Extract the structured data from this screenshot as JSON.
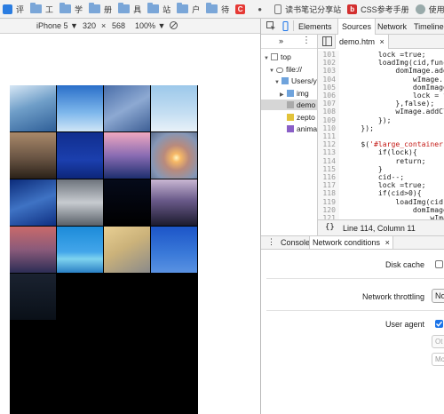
{
  "bookmarks": [
    {
      "label": "评",
      "icon": "browser-icon",
      "color": "#2b7de1"
    },
    {
      "label": "工",
      "icon": "folder-icon"
    },
    {
      "label": "学",
      "icon": "folder-icon"
    },
    {
      "label": "册",
      "icon": "folder-icon"
    },
    {
      "label": "具",
      "icon": "folder-icon"
    },
    {
      "label": "站",
      "icon": "folder-icon"
    },
    {
      "label": "户",
      "icon": "folder-icon"
    },
    {
      "label": "待",
      "icon": "folder-icon"
    },
    {
      "label": "",
      "icon": "c-logo-icon",
      "color": "#e53935"
    },
    {
      "label": "",
      "icon": "apple-icon"
    },
    {
      "label": "读书笔记分享站",
      "icon": "document-icon"
    },
    {
      "label": "CSS参考手册",
      "icon": "b-logo-icon",
      "color": "#d32f2f"
    },
    {
      "label": "使用ES6编写",
      "icon": "user-icon"
    }
  ],
  "device_toolbar": {
    "device": "iPhone 5 ▼",
    "width": "320",
    "times": "×",
    "height": "568",
    "zoom": "100% ▼"
  },
  "viewport": {
    "tiles": [
      {
        "name": "blossom-photo",
        "bg": "linear-gradient(160deg,#d7e7f5 0%,#6f9ec8 45%,#2f5f98 100%)"
      },
      {
        "name": "blue-sky-photo",
        "bg": "linear-gradient(180deg,#2a6fc9 0%,#7fb8ec 60%,#cfe5f6 100%)"
      },
      {
        "name": "cloud-sky-photo",
        "bg": "linear-gradient(150deg,#4a6ea9 0%,#8da9d2 50%,#3e5f95 100%)"
      },
      {
        "name": "pale-sky-photo",
        "bg": "linear-gradient(180deg,#9cc8ea 0%,#c4def2 60%,#e8f1f8 100%)"
      },
      {
        "name": "branches-sunset-photo",
        "bg": "linear-gradient(180deg,#a9896a 0%,#6a5544 55%,#2a2118 100%)"
      },
      {
        "name": "deep-blue-photo",
        "bg": "linear-gradient(180deg,#102e8e 0%,#1b3fae 60%,#0d2679 100%)"
      },
      {
        "name": "pink-clouds-photo",
        "bg": "linear-gradient(180deg,#f0a8c0 0%,#8a6cb3 50%,#1d2e6e 100%)"
      },
      {
        "name": "sunset-sun-photo",
        "bg": "radial-gradient(circle at 55% 55%,#fff6c2 0%,#f6b866 12%,#b98a7c 35%,#8697b6 70%,#5a6e8e 100%)"
      },
      {
        "name": "blue-clouds-photo",
        "bg": "linear-gradient(160deg,#0b2b7a 0%,#3f73c4 50%,#0e2f82 100%)"
      },
      {
        "name": "grey-clouds-photo",
        "bg": "linear-gradient(180deg,#6d737c 0%,#c7cbd0 50%,#596068 100%)"
      },
      {
        "name": "night-photo",
        "bg": "linear-gradient(180deg,#050a1a 0%,#000 100%)"
      },
      {
        "name": "bare-tree-photo",
        "bg": "linear-gradient(180deg,#c9b7d3 0%,#6a5a8a 45%,#1c1b2e 100%)"
      },
      {
        "name": "red-dusk-photo",
        "bg": "linear-gradient(180deg,#c96a6a 0%,#8a5a7a 50%,#2c2d55 100%)"
      },
      {
        "name": "sea-horizon-photo",
        "bg": "linear-gradient(180deg,#1c8bd9 0%,#43a6ea 55%,#7ed3ef 70%,#2a80c4 100%)"
      },
      {
        "name": "golden-clouds-photo",
        "bg": "linear-gradient(150deg,#e8cf93 0%,#cbb27a 45%,#8a8a8a 100%)"
      },
      {
        "name": "clear-blue-photo",
        "bg": "linear-gradient(180deg,#1c55c8 0%,#3b7ad9 60%,#5a92e2 100%)"
      },
      {
        "name": "starry-night-photo",
        "bg": "linear-gradient(180deg,#1a2230 0%,#0a1018 100%)"
      }
    ]
  },
  "devtools": {
    "tabs": [
      "Elements",
      "Sources",
      "Network",
      "Timeline"
    ],
    "active_tab": "Sources",
    "navigator_tree": [
      {
        "label": "top",
        "icon": "frame-icon",
        "indent": 0,
        "arrow": "▼"
      },
      {
        "label": "file://",
        "icon": "cloud-icon",
        "indent": 1,
        "arrow": "▼"
      },
      {
        "label": "Users/y",
        "icon": "folder-icon",
        "indent": 2,
        "arrow": "▼"
      },
      {
        "label": "img",
        "icon": "folder-icon",
        "indent": 3,
        "arrow": "▶"
      },
      {
        "label": "demo",
        "icon": "file-icon",
        "indent": 3,
        "arrow": "",
        "selected": true
      },
      {
        "label": "zepto",
        "icon": "js-file-icon",
        "indent": 3,
        "arrow": ""
      },
      {
        "label": "anima",
        "icon": "css-file-icon",
        "indent": 3,
        "arrow": ""
      }
    ],
    "editor_tab": "demo.htm",
    "code_lines": [
      {
        "num": "101",
        "text": "        lock =true;"
      },
      {
        "num": "102",
        "text": "        loadImg(cid,functi"
      },
      {
        "num": "103",
        "text": "            domImage.addE"
      },
      {
        "num": "104",
        "text": "                wImage.re"
      },
      {
        "num": "105",
        "text": "                domImage."
      },
      {
        "num": "106",
        "text": "                lock = fa"
      },
      {
        "num": "107",
        "text": "            },false);"
      },
      {
        "num": "108",
        "text": "            wImage.addCla"
      },
      {
        "num": "109",
        "text": "        });"
      },
      {
        "num": "110",
        "text": "    });"
      },
      {
        "num": "111",
        "text": ""
      },
      {
        "num": "112",
        "text": "    $('#large_container')"
      },
      {
        "num": "113",
        "text": "        if(lock){"
      },
      {
        "num": "114",
        "text": "            return;"
      },
      {
        "num": "115",
        "text": "        }"
      },
      {
        "num": "116",
        "text": "        cid--;"
      },
      {
        "num": "117",
        "text": "        lock =true;"
      },
      {
        "num": "118",
        "text": "        if(cid>0){"
      },
      {
        "num": "119",
        "text": "            loadImg(cid,fu"
      },
      {
        "num": "120",
        "text": "                domImage."
      },
      {
        "num": "121",
        "text": "                    wImage"
      }
    ],
    "status": "Line 114, Column 11",
    "drawer_tabs": [
      "Console",
      "Network conditions"
    ],
    "network_conditions": {
      "disk_cache_label": "Disk cache",
      "throttling_label": "Network throttling",
      "throttling_value": "No",
      "user_agent_label": "User agent",
      "ua_option_1": "Ot",
      "ua_option_2": "Mo"
    }
  }
}
